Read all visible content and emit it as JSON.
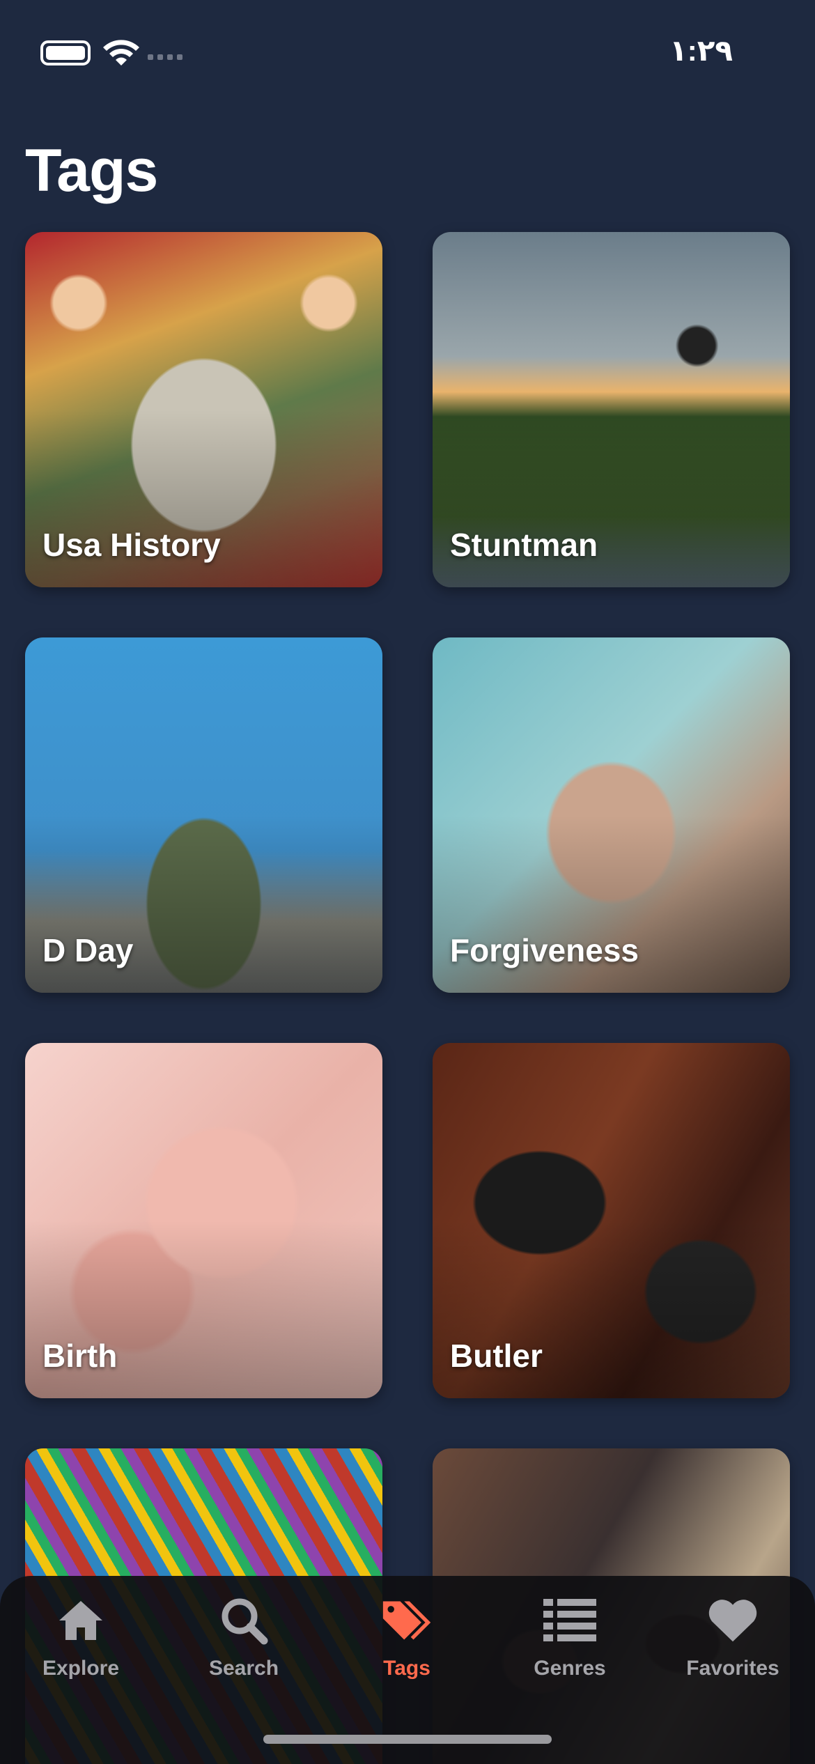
{
  "status_bar": {
    "time": "۱:۲۹"
  },
  "page": {
    "title": "Tags"
  },
  "tags": [
    {
      "label": "Usa History"
    },
    {
      "label": "Stuntman"
    },
    {
      "label": "D Day"
    },
    {
      "label": "Forgiveness"
    },
    {
      "label": "Birth"
    },
    {
      "label": "Butler"
    },
    {
      "label": ""
    },
    {
      "label": ""
    }
  ],
  "tab_bar": {
    "items": [
      {
        "label": "Explore",
        "icon": "home-icon",
        "active": false
      },
      {
        "label": "Search",
        "icon": "search-icon",
        "active": false
      },
      {
        "label": "Tags",
        "icon": "tags-icon",
        "active": true
      },
      {
        "label": "Genres",
        "icon": "list-icon",
        "active": false
      },
      {
        "label": "Favorites",
        "icon": "heart-icon",
        "active": false
      }
    ],
    "active_color": "#ff6a4d",
    "inactive_color": "#a5a5aa"
  },
  "colors": {
    "background": "#1e2940"
  }
}
